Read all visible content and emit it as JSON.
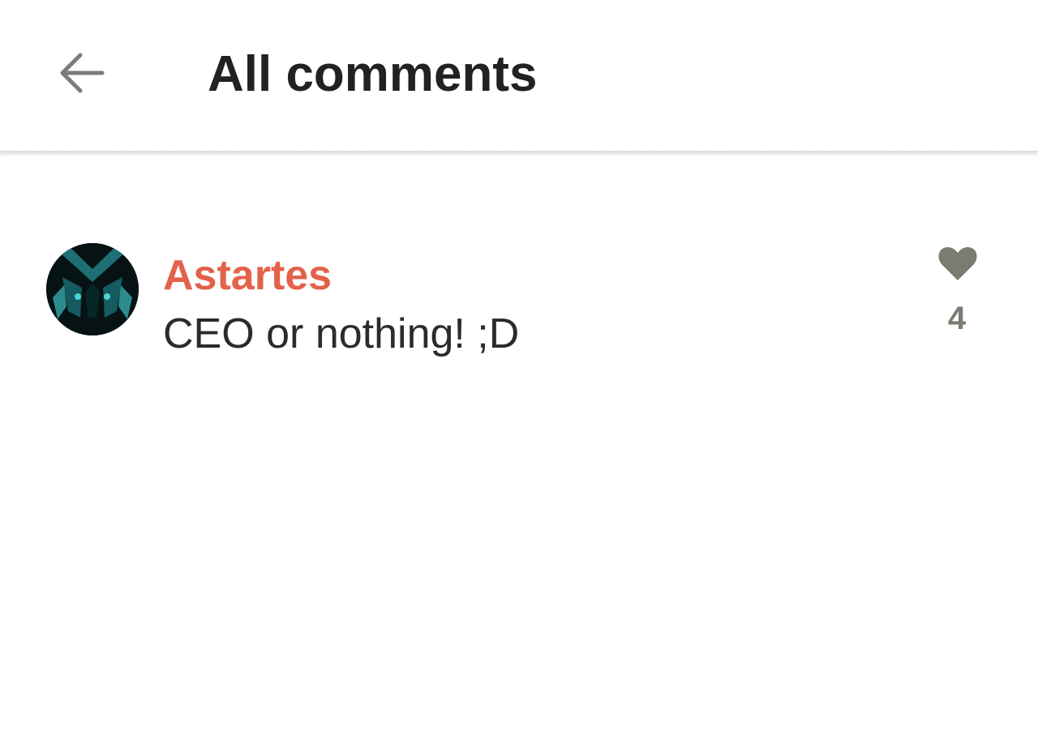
{
  "header": {
    "back_icon": "arrow-left-icon",
    "title": "All comments"
  },
  "comments": [
    {
      "author": "Astartes",
      "text": "CEO or nothing! ;D",
      "likes": "4",
      "like_icon": "heart-icon",
      "author_color": "#e3624a"
    }
  ],
  "colors": {
    "author": "#e3624a",
    "like": "#7b7b72",
    "text": "#2b2b2b"
  }
}
